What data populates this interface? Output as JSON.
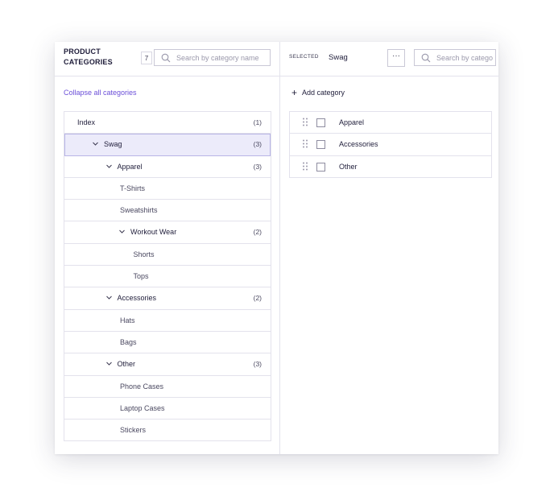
{
  "left_header": {
    "title": "Product Categories",
    "count": "7",
    "search_placeholder": "Search by category name",
    "search_icon": "search-icon"
  },
  "right_header": {
    "selected_label": "Selected",
    "selected_value": "Swag",
    "more_label": "···",
    "search_placeholder": "Search by category name",
    "search_icon": "search-icon"
  },
  "collapse_link": "Collapse all categories",
  "tree": [
    {
      "label": "Index",
      "count": "(1)",
      "depth": 0,
      "expandable": false,
      "leaf": false,
      "selected": false
    },
    {
      "label": "Swag",
      "count": "(3)",
      "depth": 1,
      "expandable": true,
      "leaf": false,
      "selected": true
    },
    {
      "label": "Apparel",
      "count": "(3)",
      "depth": 2,
      "expandable": true,
      "leaf": false,
      "selected": false
    },
    {
      "label": "T-Shirts",
      "count": "",
      "depth": 3,
      "expandable": false,
      "leaf": true,
      "selected": false
    },
    {
      "label": "Sweatshirts",
      "count": "",
      "depth": 3,
      "expandable": false,
      "leaf": true,
      "selected": false
    },
    {
      "label": "Workout Wear",
      "count": "(2)",
      "depth": 3,
      "expandable": true,
      "leaf": false,
      "selected": false
    },
    {
      "label": "Shorts",
      "count": "",
      "depth": 4,
      "expandable": false,
      "leaf": true,
      "selected": false
    },
    {
      "label": "Tops",
      "count": "",
      "depth": 4,
      "expandable": false,
      "leaf": true,
      "selected": false
    },
    {
      "label": "Accessories",
      "count": "(2)",
      "depth": 2,
      "expandable": true,
      "leaf": false,
      "selected": false
    },
    {
      "label": "Hats",
      "count": "",
      "depth": 3,
      "expandable": false,
      "leaf": true,
      "selected": false
    },
    {
      "label": "Bags",
      "count": "",
      "depth": 3,
      "expandable": false,
      "leaf": true,
      "selected": false
    },
    {
      "label": "Other",
      "count": "(3)",
      "depth": 2,
      "expandable": true,
      "leaf": false,
      "selected": false
    },
    {
      "label": "Phone Cases",
      "count": "",
      "depth": 3,
      "expandable": false,
      "leaf": true,
      "selected": false
    },
    {
      "label": "Laptop Cases",
      "count": "",
      "depth": 3,
      "expandable": false,
      "leaf": true,
      "selected": false
    },
    {
      "label": "Stickers",
      "count": "",
      "depth": 3,
      "expandable": false,
      "leaf": true,
      "selected": false
    }
  ],
  "add_category_label": "Add category",
  "children": [
    {
      "label": "Apparel",
      "checked": false
    },
    {
      "label": "Accessories",
      "checked": false
    },
    {
      "label": "Other",
      "checked": false
    }
  ],
  "colors": {
    "accent": "#6b4fd8",
    "selected_row_bg": "#ecebfa",
    "border": "#e3e2ec",
    "text": "#1f1d3a"
  }
}
